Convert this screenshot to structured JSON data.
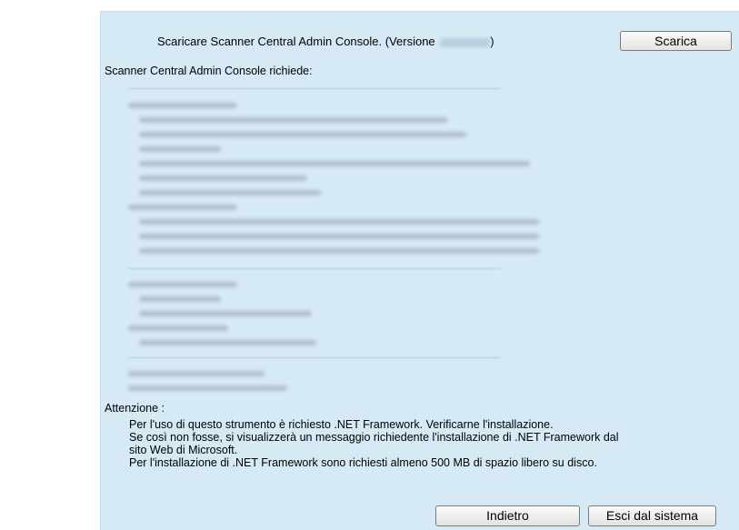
{
  "header": {
    "title_prefix": "Scaricare Scanner Central Admin Console. (Versione ",
    "title_suffix": ")"
  },
  "buttons": {
    "download": "Scarica",
    "back": "Indietro",
    "exit": "Esci dal sistema"
  },
  "requirements_label": "Scanner Central Admin Console richiede:",
  "attention": {
    "title": "Attenzione :",
    "lines": [
      "Per l'uso di questo strumento è richiesto .NET Framework. Verificarne l'installazione.",
      "Se così non fosse, si visualizzerà un messaggio richiedente l'installazione di .NET Framework dal",
      "sito Web di Microsoft.",
      "Per l'installazione di .NET Framework sono richiesti almeno 500 MB di spazio libero su disco."
    ]
  },
  "colors": {
    "panel_background": "#d6eaf6",
    "blurred_text": "#a9b7c2"
  }
}
